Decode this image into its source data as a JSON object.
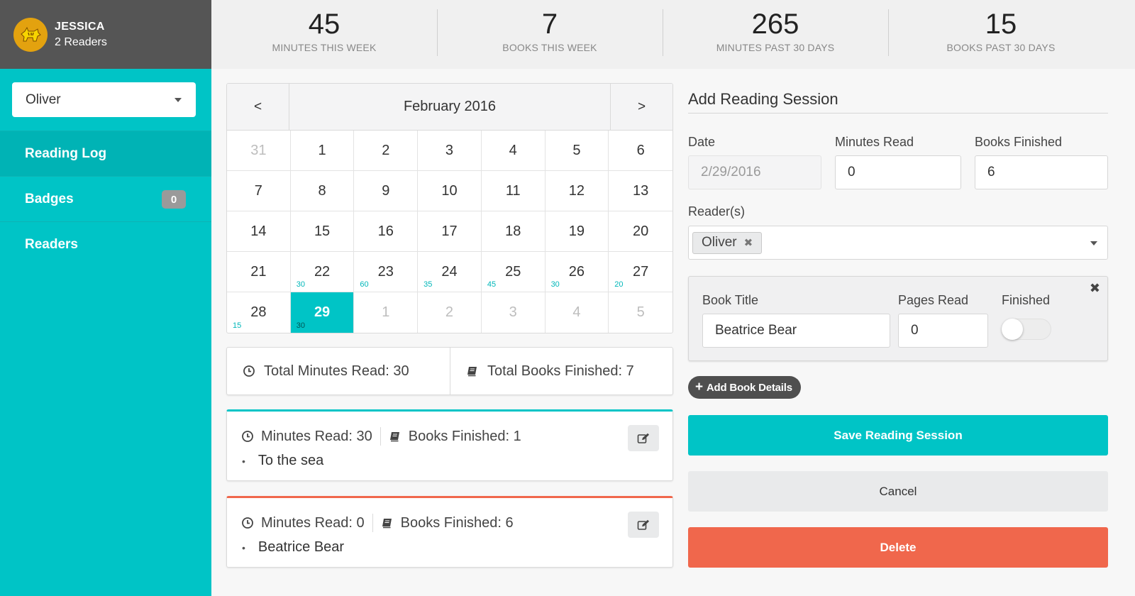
{
  "profile": {
    "name": "JESSICA",
    "readers": "2 Readers"
  },
  "reader_select": {
    "value": "Oliver"
  },
  "nav": [
    {
      "label": "Reading Log",
      "active": true
    },
    {
      "label": "Badges",
      "badge": "0"
    },
    {
      "label": "Readers"
    }
  ],
  "stats": [
    {
      "value": "45",
      "label": "MINUTES THIS WEEK"
    },
    {
      "value": "7",
      "label": "BOOKS THIS WEEK"
    },
    {
      "value": "265",
      "label": "MINUTES PAST 30 DAYS"
    },
    {
      "value": "15",
      "label": "BOOKS PAST 30 DAYS"
    }
  ],
  "calendar": {
    "prev": "<",
    "next": ">",
    "title": "February 2016",
    "days": [
      {
        "d": "31",
        "muted": true
      },
      {
        "d": "1"
      },
      {
        "d": "2"
      },
      {
        "d": "3"
      },
      {
        "d": "4"
      },
      {
        "d": "5"
      },
      {
        "d": "6"
      },
      {
        "d": "7"
      },
      {
        "d": "8"
      },
      {
        "d": "9"
      },
      {
        "d": "10"
      },
      {
        "d": "11"
      },
      {
        "d": "12"
      },
      {
        "d": "13"
      },
      {
        "d": "14"
      },
      {
        "d": "15"
      },
      {
        "d": "16"
      },
      {
        "d": "17"
      },
      {
        "d": "18"
      },
      {
        "d": "19"
      },
      {
        "d": "20"
      },
      {
        "d": "21"
      },
      {
        "d": "22",
        "m": "30"
      },
      {
        "d": "23",
        "m": "60"
      },
      {
        "d": "24",
        "m": "35"
      },
      {
        "d": "25",
        "m": "45"
      },
      {
        "d": "26",
        "m": "30"
      },
      {
        "d": "27",
        "m": "20"
      },
      {
        "d": "28",
        "m": "15"
      },
      {
        "d": "29",
        "m": "30",
        "selected": true
      },
      {
        "d": "1",
        "muted": true
      },
      {
        "d": "2",
        "muted": true
      },
      {
        "d": "3",
        "muted": true
      },
      {
        "d": "4",
        "muted": true
      },
      {
        "d": "5",
        "muted": true
      }
    ]
  },
  "totals": {
    "minutes": "Total Minutes Read: 30",
    "books": "Total Books Finished: 7"
  },
  "sessions": [
    {
      "minutes": "Minutes Read: 30",
      "books": "Books Finished: 1",
      "book": "To the sea",
      "accent": "#00c4c6"
    },
    {
      "minutes": "Minutes Read: 0",
      "books": "Books Finished: 6",
      "book": "Beatrice Bear",
      "accent": "#f0674c"
    }
  ],
  "form": {
    "title": "Add Reading Session",
    "date_label": "Date",
    "date_value": "2/29/2016",
    "minutes_label": "Minutes Read",
    "minutes_value": "0",
    "books_label": "Books Finished",
    "books_value": "6",
    "readers_label": "Reader(s)",
    "reader_chip": "Oliver",
    "book": {
      "title_label": "Book Title",
      "title_value": "Beatrice Bear",
      "pages_label": "Pages Read",
      "pages_value": "0",
      "finished_label": "Finished",
      "finished": false
    },
    "add_book": "Add Book Details",
    "save": "Save Reading Session",
    "cancel": "Cancel",
    "delete": "Delete"
  },
  "colors": {
    "accent": "#00c4c6",
    "danger": "#f0674c",
    "sidebar_dark": "#555555"
  },
  "icons": {
    "avatar": "tiger-icon",
    "clock": "clock-icon",
    "book": "book-icon",
    "edit": "edit-icon",
    "remove": "close-icon",
    "add": "plus-icon"
  }
}
